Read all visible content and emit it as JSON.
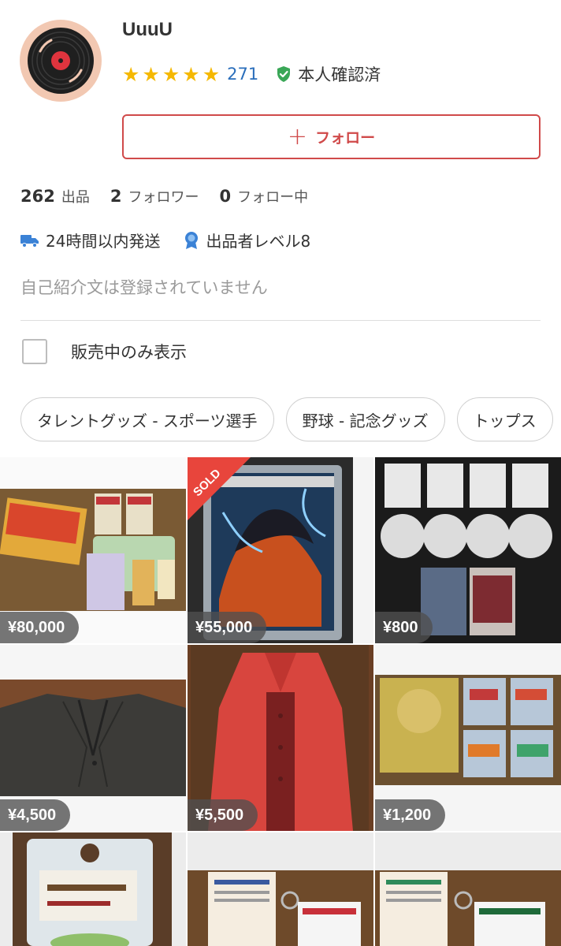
{
  "profile": {
    "username": "UuuU",
    "stars": 5,
    "rating_count": "271",
    "verified_label": "本人確認済",
    "follow_label": "フォロー"
  },
  "stats": [
    {
      "num": "262",
      "label": "出品"
    },
    {
      "num": "2",
      "label": "フォロワー"
    },
    {
      "num": "0",
      "label": "フォロー中"
    }
  ],
  "badges": [
    {
      "icon": "truck-icon",
      "label": "24時間以内発送"
    },
    {
      "icon": "medal-icon",
      "label": "出品者レベル8"
    }
  ],
  "bio": "自己紹介文は登録されていません",
  "filter": {
    "label": "販売中のみ表示",
    "checked": false
  },
  "categories": [
    "タレントグッズ - スポーツ選手",
    "野球 - 記念グッズ",
    "トップス"
  ],
  "items": [
    {
      "price": "¥80,000",
      "sold": false
    },
    {
      "price": "¥55,000",
      "sold": true,
      "sold_label": "SOLD"
    },
    {
      "price": "¥800",
      "sold": false
    },
    {
      "price": "¥4,500",
      "sold": false
    },
    {
      "price": "¥5,500",
      "sold": false
    },
    {
      "price": "¥1,200",
      "sold": false
    },
    {
      "price": "",
      "sold": false
    },
    {
      "price": "",
      "sold": false
    },
    {
      "price": "",
      "sold": false
    }
  ],
  "colors": {
    "accent": "#d04a4a",
    "star": "#f5b800",
    "link": "#2a6ebb",
    "verify": "#3aa757",
    "badge": "#3b82d6"
  }
}
